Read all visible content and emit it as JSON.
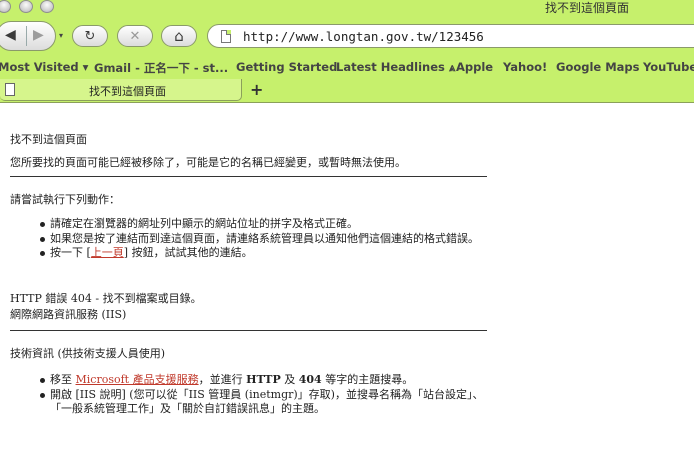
{
  "window": {
    "title": "找不到這個頁面"
  },
  "toolbar": {
    "url": "http://www.longtan.gov.tw/123456",
    "back_glyph": "◀",
    "forward_glyph": "▶",
    "dropdown_glyph": "▾",
    "reload_glyph": "↻",
    "stop_glyph": "✕",
    "home_glyph": "⌂"
  },
  "bookmarks": [
    "Most Visited ▾",
    "Gmail - 正名一下 - st...",
    "Getting Started",
    "Latest Headlines ⩓",
    "Apple",
    "Yahoo!",
    "Google Maps",
    "YouTube"
  ],
  "tabs": [
    {
      "label": "找不到這個頁面"
    }
  ],
  "new_tab_glyph": "+",
  "page": {
    "title": "找不到這個頁面",
    "subtitle": "您所要找的頁面可能已經被移除了，可能是它的名稱已經變更，或暫時無法使用。",
    "try_heading": "請嘗試執行下列動作：",
    "bullets1": {
      "b1": "請確定在瀏覽器的網址列中顯示的網站位址的拼字及格式正確。",
      "b2": "如果您是按了連結而到達這個頁面，請連絡系統管理員以通知他們這個連結的格式錯誤。",
      "b3_pre": "按一下 [",
      "b3_link": "上一頁",
      "b3_post": "] 按鈕，試試其他的連結。"
    },
    "error_line": "HTTP 錯誤 404 - 找不到檔案或目錄。",
    "service_line": "網際網路資訊服務 (IIS)",
    "tech_heading": "技術資訊 (供技術支援人員使用)",
    "bullets2": {
      "b1_pre": "移至 ",
      "b1_link": "Microsoft 產品支援服務",
      "b1_mid": "，並進行 ",
      "b1_bold1": "HTTP",
      "b1_and": " 及 ",
      "b1_bold2": "404",
      "b1_post": " 等字的主題搜尋。",
      "b2": "開啟 [IIS 說明] (您可以從「IIS 管理員 (inetmgr)」存取)，並搜尋名稱為「站台設定」、「一般系統管理工作」及「關於自訂錯誤訊息」的主題。"
    }
  },
  "colors": {
    "chrome": "#c6f06c",
    "link": "#c0392b"
  }
}
